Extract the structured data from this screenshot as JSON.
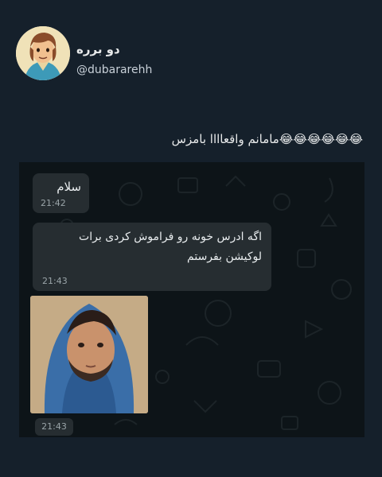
{
  "author": {
    "display_name": "دو برره",
    "handle": "@dubararehh"
  },
  "tweet": {
    "text": "😂😂😂😂😂😂مامانم واقعاااا بامزس"
  },
  "chat": {
    "messages": [
      {
        "text": "سلام",
        "time": "21:42"
      },
      {
        "text": "اگه ادرس خونه رو فراموش کردی برات لوکیشن بفرستم",
        "time": "21:43"
      },
      {
        "type": "image",
        "time": "21:43"
      }
    ]
  }
}
